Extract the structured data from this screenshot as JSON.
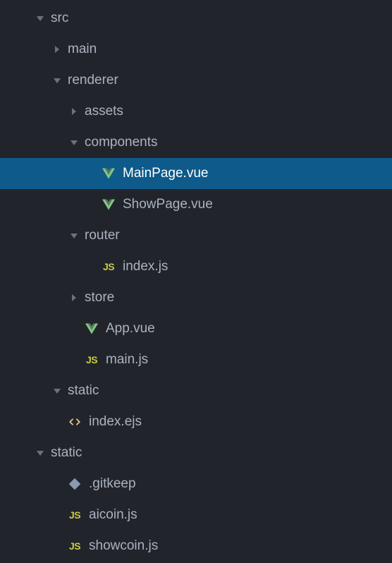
{
  "tree": [
    {
      "label": "src",
      "type": "folder",
      "expanded": true,
      "indent": 0,
      "icon": "folder",
      "selected": false
    },
    {
      "label": "main",
      "type": "folder",
      "expanded": false,
      "indent": 1,
      "icon": "folder",
      "selected": false
    },
    {
      "label": "renderer",
      "type": "folder",
      "expanded": true,
      "indent": 1,
      "icon": "folder",
      "selected": false
    },
    {
      "label": "assets",
      "type": "folder",
      "expanded": false,
      "indent": 2,
      "icon": "folder",
      "selected": false
    },
    {
      "label": "components",
      "type": "folder",
      "expanded": true,
      "indent": 2,
      "icon": "folder",
      "selected": false
    },
    {
      "label": "MainPage.vue",
      "type": "file",
      "indent": 3,
      "icon": "vue",
      "selected": true
    },
    {
      "label": "ShowPage.vue",
      "type": "file",
      "indent": 3,
      "icon": "vue",
      "selected": false
    },
    {
      "label": "router",
      "type": "folder",
      "expanded": true,
      "indent": 2,
      "icon": "folder",
      "selected": false
    },
    {
      "label": "index.js",
      "type": "file",
      "indent": 3,
      "icon": "js",
      "selected": false
    },
    {
      "label": "store",
      "type": "folder",
      "expanded": false,
      "indent": 2,
      "icon": "folder",
      "selected": false
    },
    {
      "label": "App.vue",
      "type": "file",
      "indent": 2,
      "icon": "vue",
      "selected": false
    },
    {
      "label": "main.js",
      "type": "file",
      "indent": 2,
      "icon": "js",
      "selected": false
    },
    {
      "label": "static",
      "type": "folder",
      "expanded": true,
      "indent": 1,
      "icon": "folder",
      "selected": false
    },
    {
      "label": "index.ejs",
      "type": "file",
      "indent": 1,
      "icon": "ejs",
      "selected": false
    },
    {
      "label": "static",
      "type": "folder",
      "expanded": true,
      "indent": 0,
      "icon": "folder",
      "selected": false
    },
    {
      "label": ".gitkeep",
      "type": "file",
      "indent": 1,
      "icon": "git",
      "selected": false
    },
    {
      "label": "aicoin.js",
      "type": "file",
      "indent": 1,
      "icon": "js",
      "selected": false
    },
    {
      "label": "showcoin.js",
      "type": "file",
      "indent": 1,
      "icon": "js",
      "selected": false
    }
  ],
  "colors": {
    "vue": "#81c784",
    "js": "#cbcb41",
    "ejs": "#e2c08d",
    "git": "#8a9bb0"
  }
}
